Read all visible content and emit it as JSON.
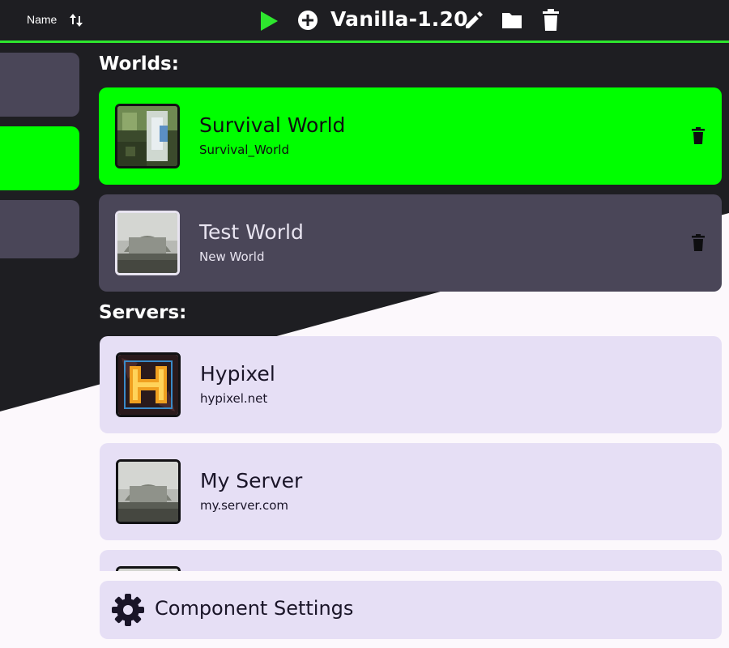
{
  "toolbar": {
    "sort_label": "Name",
    "sort_icon": "sort-arrows-icon",
    "play_icon": "play-icon",
    "add_icon": "add-circle-icon",
    "profile_title": "Vanilla-1.20",
    "edit_icon": "pencil-icon",
    "folder_icon": "folder-icon",
    "delete_icon": "trash-icon"
  },
  "sidebar": {
    "tabs": [
      {
        "state": "normal"
      },
      {
        "state": "selected"
      },
      {
        "state": "normal"
      }
    ]
  },
  "worlds": {
    "heading": "Worlds:",
    "items": [
      {
        "title": "Survival World",
        "subtitle": "Survival_World",
        "selected": true,
        "thumbnail": "world-thumbnail-icon"
      },
      {
        "title": "Test World",
        "subtitle": "New World",
        "selected": false,
        "thumbnail": "world-thumbnail-icon"
      }
    ]
  },
  "servers": {
    "heading": "Servers:",
    "items": [
      {
        "title": "Hypixel",
        "subtitle": "hypixel.net",
        "thumbnail": "hypixel-logo-icon"
      },
      {
        "title": "My Server",
        "subtitle": "my.server.com",
        "thumbnail": "server-thumbnail-icon"
      },
      {
        "title": "",
        "subtitle": "",
        "thumbnail": "server-thumbnail-icon"
      }
    ]
  },
  "settings": {
    "label": "Component Settings",
    "icon": "gear-icon"
  },
  "colors": {
    "accent_green": "#00ff00",
    "bar_border": "#2ee62e",
    "dark_bg": "#1e1e22",
    "card_dark": "#4a4658",
    "card_light": "#e6dff5",
    "light_bg": "#fcf8fc"
  }
}
